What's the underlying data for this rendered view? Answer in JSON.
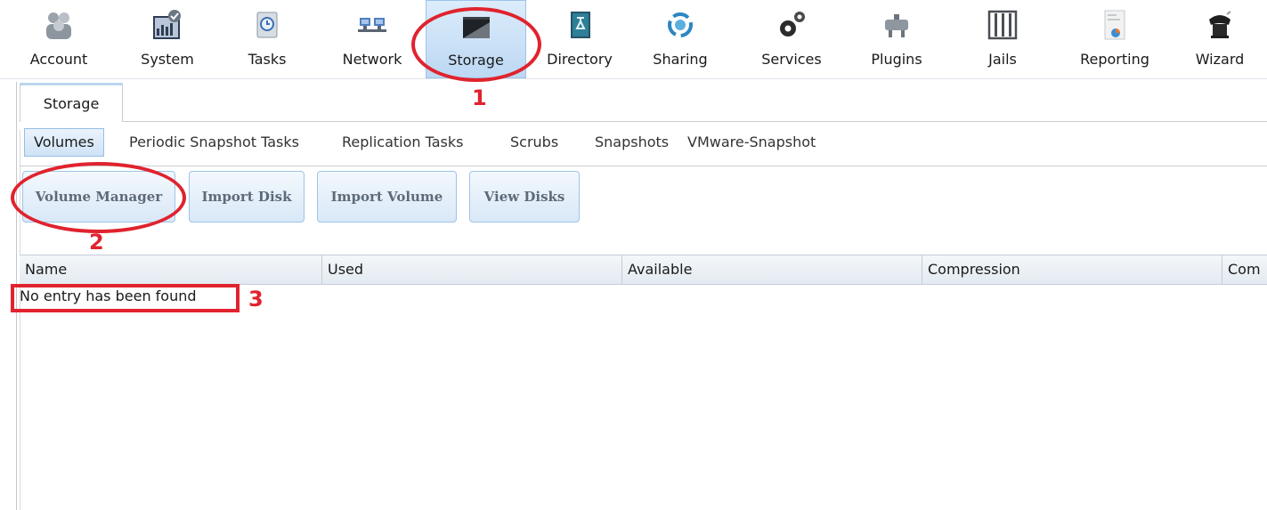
{
  "toolbar": {
    "items": [
      {
        "label": "Account",
        "icon": "account-icon"
      },
      {
        "label": "System",
        "icon": "system-icon"
      },
      {
        "label": "Tasks",
        "icon": "tasks-icon"
      },
      {
        "label": "Network",
        "icon": "network-icon"
      },
      {
        "label": "Storage",
        "icon": "storage-icon",
        "active": true
      },
      {
        "label": "Directory",
        "icon": "directory-icon"
      },
      {
        "label": "Sharing",
        "icon": "sharing-icon"
      },
      {
        "label": "Services",
        "icon": "services-icon"
      },
      {
        "label": "Plugins",
        "icon": "plugins-icon"
      },
      {
        "label": "Jails",
        "icon": "jails-icon"
      },
      {
        "label": "Reporting",
        "icon": "reporting-icon"
      },
      {
        "label": "Wizard",
        "icon": "wizard-icon"
      }
    ]
  },
  "tabs": {
    "storage_tab": "Storage"
  },
  "subtabs": {
    "items": [
      "Volumes",
      "Periodic Snapshot Tasks",
      "Replication Tasks",
      "Scrubs",
      "Snapshots",
      "VMware-Snapshot"
    ],
    "active": "Volumes"
  },
  "actions": {
    "volume_manager": "Volume Manager",
    "import_disk": "Import Disk",
    "import_volume": "Import Volume",
    "view_disks": "View Disks"
  },
  "grid": {
    "columns": [
      "Name",
      "Used",
      "Available",
      "Compression",
      "Com"
    ],
    "empty_message": "No entry has been found"
  },
  "annotations": {
    "step1": "1",
    "step2": "2",
    "step3": "3",
    "color": "#e0232e"
  },
  "colors": {
    "active_tab_bg": "#bcd8f3",
    "button_text": "#5e6a78",
    "button_border": "#9ec4e8"
  }
}
